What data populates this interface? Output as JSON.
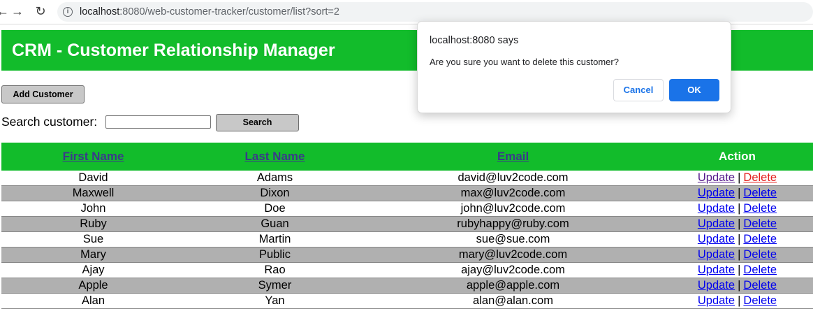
{
  "browser": {
    "url_host": "localhost",
    "url_rest": ":8080/web-customer-tracker/customer/list?sort=2"
  },
  "header": {
    "title": "CRM - Customer Relationship Manager"
  },
  "toolbar": {
    "add_label": "Add Customer",
    "search_label": "Search customer:",
    "search_value": "",
    "search_button": "Search"
  },
  "table": {
    "headers": [
      "First Name",
      "Last Name",
      "Email",
      "Action"
    ],
    "update_label": "Update",
    "delete_label": "Delete",
    "separator": "|",
    "rows": [
      [
        "David",
        "Adams",
        "david@luv2code.com"
      ],
      [
        "Maxwell",
        "Dixon",
        "max@luv2code.com"
      ],
      [
        "John",
        "Doe",
        "john@luv2code.com"
      ],
      [
        "Ruby",
        "Guan",
        "rubyhappy@ruby.com"
      ],
      [
        "Sue",
        "Martin",
        "sue@sue.com"
      ],
      [
        "Mary",
        "Public",
        "mary@luv2code.com"
      ],
      [
        "Ajay",
        "Rao",
        "ajay@luv2code.com"
      ],
      [
        "Apple",
        "Symer",
        "apple@apple.com"
      ],
      [
        "Alan",
        "Yan",
        "alan@alan.com"
      ]
    ]
  },
  "dialog": {
    "title": "localhost:8080 says",
    "message": "Are you sure you want to delete this customer?",
    "cancel": "Cancel",
    "ok": "OK"
  },
  "colors": {
    "header_green": "#12bc2b",
    "row_gray": "#b0b0b0",
    "link_blue": "#0000ee",
    "delete_red": "#e4211f",
    "dialog_blue": "#1a73e8"
  }
}
